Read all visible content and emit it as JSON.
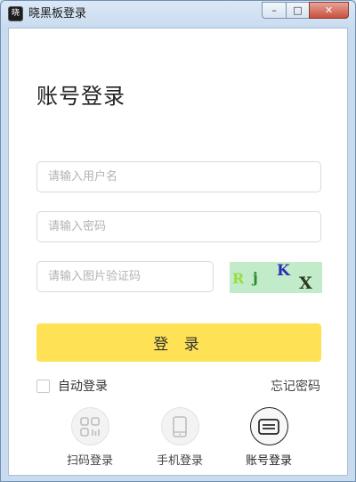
{
  "window": {
    "title": "晓黑板登录",
    "app_icon_text": "晓",
    "controls": {
      "minimize": "–",
      "maximize": "□",
      "close": "✕"
    }
  },
  "login": {
    "heading": "账号登录",
    "username_placeholder": "请输入用户名",
    "password_placeholder": "请输入密码",
    "captcha_placeholder": "请输入图片验证码",
    "captcha_chars": [
      "R",
      "j",
      "K",
      "X"
    ],
    "login_button": "登 录",
    "auto_login_label": "自动登录",
    "forgot_password": "忘记密码"
  },
  "methods": [
    {
      "label": "扫码登录",
      "icon": "qr-icon"
    },
    {
      "label": "手机登录",
      "icon": "phone-icon"
    },
    {
      "label": "账号登录",
      "icon": "account-card-icon",
      "active": true
    }
  ],
  "colors": {
    "login_button": "#fee155",
    "captcha_bg": "#c2ecc9",
    "titlebar": "#cfe0f1"
  }
}
